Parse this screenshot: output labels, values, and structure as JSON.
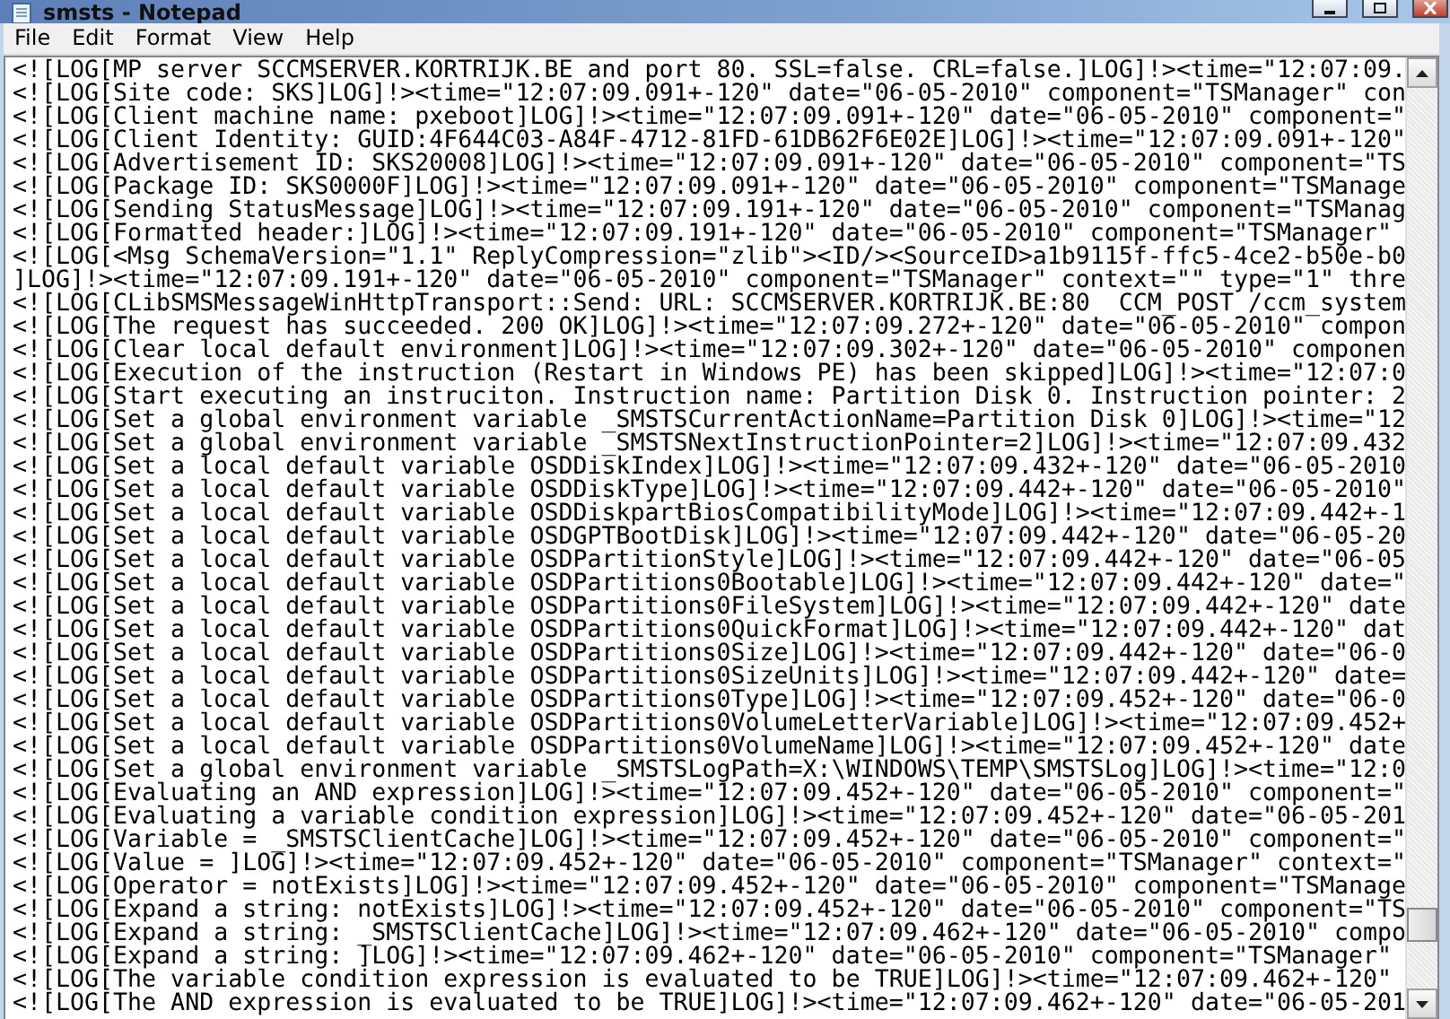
{
  "window": {
    "title": "smsts - Notepad"
  },
  "menu": [
    "File",
    "Edit",
    "Format",
    "View",
    "Help"
  ],
  "lines": [
    "<![LOG[MP server SCCMSERVER.KORTRIJK.BE and port 80. SSL=false. CRL=false.]LOG]!><time=\"12:07:09.",
    "<![LOG[Site code: SKS]LOG]!><time=\"12:07:09.091+-120\" date=\"06-05-2010\" component=\"TSManager\" con",
    "<![LOG[Client machine name: pxeboot]LOG]!><time=\"12:07:09.091+-120\" date=\"06-05-2010\" component=\"",
    "<![LOG[Client Identity: GUID:4F644C03-A84F-4712-81FD-61DB62F6E02E]LOG]!><time=\"12:07:09.091+-120\"",
    "<![LOG[Advertisement ID: SKS20008]LOG]!><time=\"12:07:09.091+-120\" date=\"06-05-2010\" component=\"TS",
    "<![LOG[Package ID: SKS0000F]LOG]!><time=\"12:07:09.091+-120\" date=\"06-05-2010\" component=\"TSManage",
    "<![LOG[Sending StatusMessage]LOG]!><time=\"12:07:09.191+-120\" date=\"06-05-2010\" component=\"TSManag",
    "<![LOG[Formatted header:]LOG]!><time=\"12:07:09.191+-120\" date=\"06-05-2010\" component=\"TSManager\"",
    "<![LOG[<Msg SchemaVersion=\"1.1\" ReplyCompression=\"zlib\"><ID/><SourceID>a1b9115f-ffc5-4ce2-b50e-b0",
    "]LOG]!><time=\"12:07:09.191+-120\" date=\"06-05-2010\" component=\"TSManager\" context=\"\" type=\"1\" thre",
    "<![LOG[CLibSMSMessageWinHttpTransport::Send: URL: SCCMSERVER.KORTRIJK.BE:80  CCM_POST /ccm_system",
    "<![LOG[The request has succeeded. 200 OK]LOG]!><time=\"12:07:09.272+-120\" date=\"06-05-2010\" compon",
    "<![LOG[Clear local default environment]LOG]!><time=\"12:07:09.302+-120\" date=\"06-05-2010\" componen",
    "<![LOG[Execution of the instruction (Restart in Windows PE) has been skipped]LOG]!><time=\"12:07:0",
    "<![LOG[Start executing an instruciton. Instruction name: Partition Disk 0. Instruction pointer: 2",
    "<![LOG[Set a global environment variable _SMSTSCurrentActionName=Partition Disk 0]LOG]!><time=\"12",
    "<![LOG[Set a global environment variable _SMSTSNextInstructionPointer=2]LOG]!><time=\"12:07:09.432",
    "<![LOG[Set a local default variable OSDDiskIndex]LOG]!><time=\"12:07:09.432+-120\" date=\"06-05-2010",
    "<![LOG[Set a local default variable OSDDiskType]LOG]!><time=\"12:07:09.442+-120\" date=\"06-05-2010\"",
    "<![LOG[Set a local default variable OSDDiskpartBiosCompatibilityMode]LOG]!><time=\"12:07:09.442+-1",
    "<![LOG[Set a local default variable OSDGPTBootDisk]LOG]!><time=\"12:07:09.442+-120\" date=\"06-05-20",
    "<![LOG[Set a local default variable OSDPartitionStyle]LOG]!><time=\"12:07:09.442+-120\" date=\"06-05",
    "<![LOG[Set a local default variable OSDPartitions0Bootable]LOG]!><time=\"12:07:09.442+-120\" date=\"",
    "<![LOG[Set a local default variable OSDPartitions0FileSystem]LOG]!><time=\"12:07:09.442+-120\" date",
    "<![LOG[Set a local default variable OSDPartitions0QuickFormat]LOG]!><time=\"12:07:09.442+-120\" dat",
    "<![LOG[Set a local default variable OSDPartitions0Size]LOG]!><time=\"12:07:09.442+-120\" date=\"06-0",
    "<![LOG[Set a local default variable OSDPartitions0SizeUnits]LOG]!><time=\"12:07:09.442+-120\" date=",
    "<![LOG[Set a local default variable OSDPartitions0Type]LOG]!><time=\"12:07:09.452+-120\" date=\"06-0",
    "<![LOG[Set a local default variable OSDPartitions0VolumeLetterVariable]LOG]!><time=\"12:07:09.452+",
    "<![LOG[Set a local default variable OSDPartitions0VolumeName]LOG]!><time=\"12:07:09.452+-120\" date",
    "<![LOG[Set a global environment variable _SMSTSLogPath=X:\\WINDOWS\\TEMP\\SMSTSLog]LOG]!><time=\"12:0",
    "<![LOG[Evaluating an AND expression]LOG]!><time=\"12:07:09.452+-120\" date=\"06-05-2010\" component=\"",
    "<![LOG[Evaluating a variable condition expression]LOG]!><time=\"12:07:09.452+-120\" date=\"06-05-201",
    "<![LOG[Variable = _SMSTSClientCache]LOG]!><time=\"12:07:09.452+-120\" date=\"06-05-2010\" component=\"",
    "<![LOG[Value = ]LOG]!><time=\"12:07:09.452+-120\" date=\"06-05-2010\" component=\"TSManager\" context=\"",
    "<![LOG[Operator = notExists]LOG]!><time=\"12:07:09.452+-120\" date=\"06-05-2010\" component=\"TSManage",
    "<![LOG[Expand a string: notExists]LOG]!><time=\"12:07:09.452+-120\" date=\"06-05-2010\" component=\"TS",
    "<![LOG[Expand a string: _SMSTSClientCache]LOG]!><time=\"12:07:09.462+-120\" date=\"06-05-2010\" compo",
    "<![LOG[Expand a string: ]LOG]!><time=\"12:07:09.462+-120\" date=\"06-05-2010\" component=\"TSManager\"",
    "<![LOG[The variable condition expression is evaluated to be TRUE]LOG]!><time=\"12:07:09.462+-120\"",
    "<![LOG[The AND expression is evaluated to be TRUE]LOG]!><time=\"12:07:09.462+-120\" date=\"06-05-201"
  ]
}
